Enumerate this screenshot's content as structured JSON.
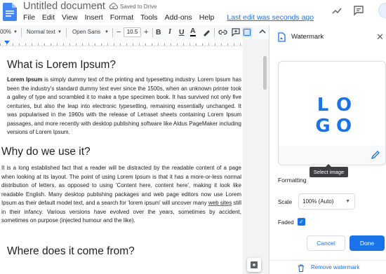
{
  "header": {
    "doc_title": "Untitled document",
    "save_status": "Saved to Drive",
    "menu": [
      "File",
      "Edit",
      "View",
      "Insert",
      "Format",
      "Tools",
      "Add-ons",
      "Help"
    ],
    "last_edit": "Last edit was seconds ago"
  },
  "toolbar": {
    "zoom": "00%",
    "style": "Normal text",
    "font": "Open Sans",
    "font_size": "10.5",
    "bold": "B",
    "italic": "I",
    "underline": "U",
    "text_color": "A"
  },
  "document": {
    "heading1": "What is Lorem Ipsum?",
    "para1_bold": "Lorem Ipsum",
    "para1_rest": " is simply dummy text of the printing and typesetting industry. Lorem Ipsum has been the industry's standard dummy text ever since the 1500s, when an unknown printer took a galley of type and scrambled it to make a type specimen book. It has survived not only five centuries, but also the leap into electronic typesetting, remaining essentially unchanged. It was popularised in the 1960s with the release of Letraset sheets containing Lorem Ipsum passages, and more recently with desktop publishing software like Aldus PageMaker including versions of Lorem Ipsum.",
    "heading2": "Why do we use it?",
    "para2_a": "It is a long established fact that a reader will be distracted by the readable content of a page when looking at its layout. The point of using Lorem Ipsum is that it has a more-or-less normal distribution of letters, as opposed to using 'Content here, content here', making it look like readable English. Many desktop publishing packages and web page editors now use Lorem Ipsum as their default model text, and a search for 'lorem ipsum' will uncover many ",
    "para2_link": "web sites",
    "para2_b": " still in their infancy. Various versions have evolved over the years, sometimes by accident, sometimes on purpose (injected humour and the like).",
    "heading3": "Where does it come from?"
  },
  "watermark_panel": {
    "title": "Watermark",
    "logo_letters": [
      "L",
      "O",
      "G",
      "O"
    ],
    "tooltip": "Select image",
    "formatting_label": "Formatting",
    "scale_label": "Scale",
    "scale_value": "100% (Auto)",
    "faded_label": "Faded",
    "faded_checked": true,
    "cancel_label": "Cancel",
    "done_label": "Done",
    "remove_label": "Remove watermark"
  },
  "colors": {
    "accent": "#1a73e8",
    "docs_blue": "#4285f4"
  }
}
